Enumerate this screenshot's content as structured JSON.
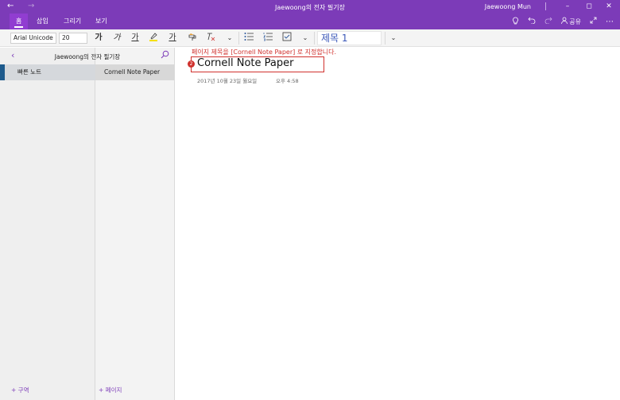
{
  "titlebar": {
    "back_glyph": "←",
    "forward_glyph": "→",
    "title": "Jaewoong의 전자 필기장",
    "user": "Jaewoong Mun",
    "minimize_glyph": "–",
    "restore_glyph": "◻",
    "close_glyph": "✕"
  },
  "ribbon": {
    "tabs": [
      {
        "label": "홈"
      },
      {
        "label": "삽입"
      },
      {
        "label": "그리기"
      },
      {
        "label": "보기"
      }
    ],
    "share_label": "공유",
    "icons": [
      "lightbulb-icon",
      "undo-icon",
      "redo-icon",
      "share-icon",
      "expand-icon",
      "more-icon"
    ]
  },
  "toolbar": {
    "font_name": "Arial Unicode",
    "font_size": "20",
    "bold_glyph": "가",
    "italic_glyph": "가",
    "underline_glyph": "가",
    "font_color_glyph": "가",
    "style_name": "제목 1"
  },
  "notebook": {
    "name": "Jaewoong의 전자 필기장",
    "sections": [
      {
        "label": "빠른 노트"
      }
    ],
    "pages": [
      {
        "label": "Cornell Note Paper"
      }
    ],
    "add_section_label": "+ 구역",
    "add_page_label": "+ 페이지"
  },
  "page": {
    "instruction": "페이지 제목을 [Cornell Note Paper] 로 지정합니다.",
    "badge": "2",
    "title": "Cornell Note Paper",
    "date": "2017년 10월 23일 월요일",
    "time": "오후 4:58"
  },
  "colors": {
    "accent": "#7c3bb8",
    "annotation": "#d0312d",
    "section_tab": "#1d5a8c"
  }
}
